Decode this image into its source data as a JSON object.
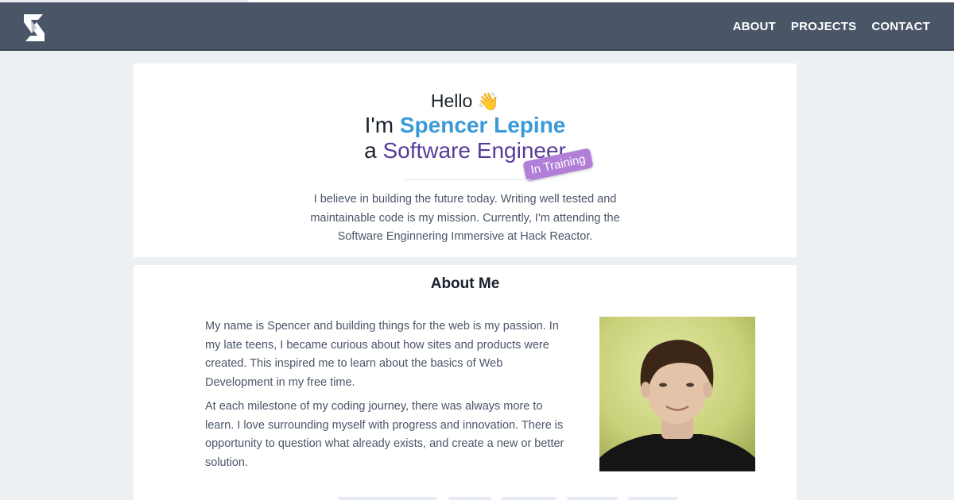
{
  "nav": {
    "links": [
      "ABOUT",
      "PROJECTS",
      "CONTACT"
    ]
  },
  "hero": {
    "hello": "Hello",
    "wave_emoji": "👋",
    "im_prefix": "I'm ",
    "name": "Spencer Lepine",
    "role_prefix": "a ",
    "role_title": "Software Engineer",
    "badge": "In Training",
    "intro": "I believe in building the future today. Writing well tested and maintainable code is my mission. Currently, I'm attending the Software Enginnering Immersive at Hack Reactor."
  },
  "about": {
    "title": "About Me",
    "paragraphs": [
      "My name is Spencer and building things for the web is my passion. In my late teens, I became curious about how sites and products were created. This inspired me to learn about the basics of Web Development in my free time.",
      "At each milestone of my coding journey, there was always more to learn. I love surrounding myself with progress and innovation. There is opportunity to question what already exists, and create a new or better solution."
    ]
  },
  "colors": {
    "navbar": "#4a5568",
    "name": "#3a9ad9",
    "role": "#553c9a",
    "badge": "#b27fd8"
  },
  "icons": {
    "logo": "logo-icon",
    "wave": "waving-hand-icon"
  }
}
